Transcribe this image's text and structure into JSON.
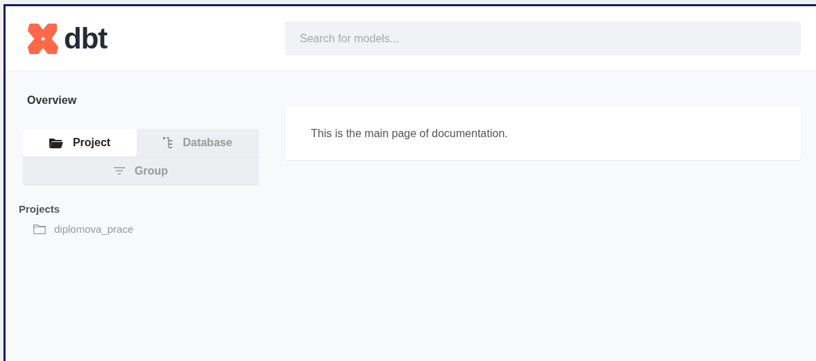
{
  "header": {
    "logo_text": "dbt",
    "search": {
      "placeholder": "Search for models..."
    }
  },
  "sidebar": {
    "title": "Overview",
    "tabs": [
      {
        "label": "Project",
        "kind": "folder",
        "selected": true
      },
      {
        "label": "Database",
        "kind": "tree",
        "selected": false
      },
      {
        "label": "Group",
        "kind": "filter",
        "selected": false
      }
    ],
    "section_title": "Projects",
    "items": [
      {
        "label": "diplomova_prace"
      }
    ]
  },
  "main": {
    "text": "This is the main page of documentation."
  }
}
